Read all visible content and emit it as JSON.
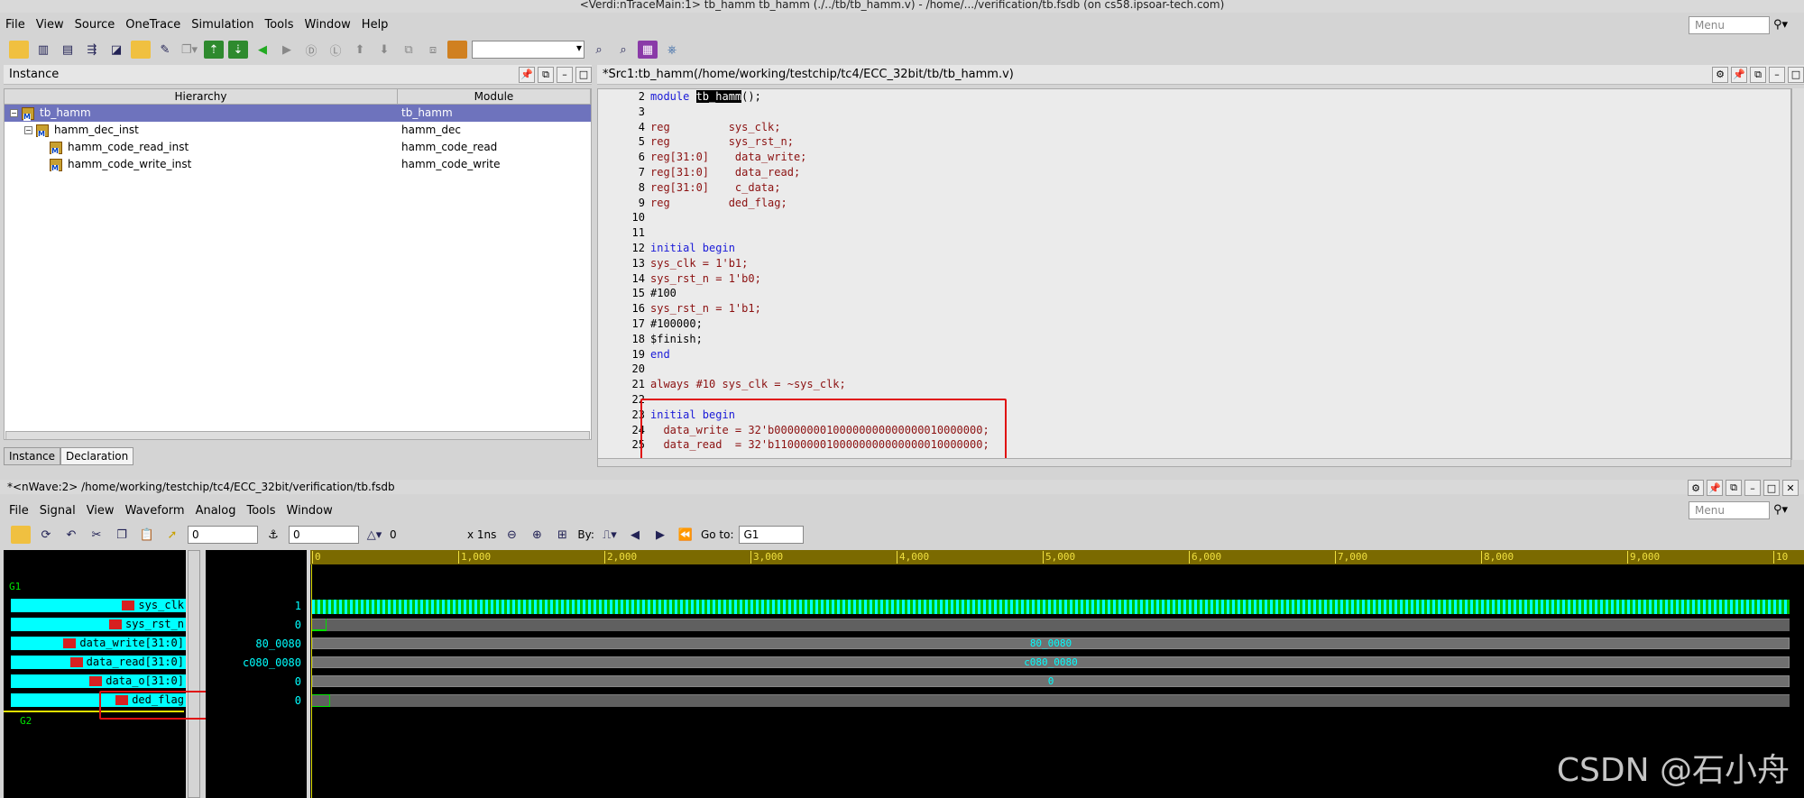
{
  "window": {
    "title": "<Verdi:nTraceMain:1> tb_hamm tb_hamm (./../tb/tb_hamm.v) - /home/.../verification/tb.fsdb (on cs58.ipsoar-tech.com)",
    "menu": [
      "File",
      "View",
      "Source",
      "OneTrace",
      "Simulation",
      "Tools",
      "Window",
      "Help"
    ],
    "menu_search_placeholder": "Menu"
  },
  "instance_panel": {
    "title": "Instance",
    "col_hierarchy": "Hierarchy",
    "col_module": "Module",
    "rows": [
      {
        "name": "tb_hamm",
        "module": "tb_hamm"
      },
      {
        "name": "hamm_dec_inst",
        "module": "hamm_dec"
      },
      {
        "name": "hamm_code_read_inst",
        "module": "hamm_code_read"
      },
      {
        "name": "hamm_code_write_inst",
        "module": "hamm_code_write"
      }
    ],
    "tabs": [
      "Instance",
      "Declaration"
    ]
  },
  "source_panel": {
    "title": "*Src1:tb_hamm(/home/working/testchip/tc4/ECC_32bit/tb/tb_hamm.v)",
    "lines": [
      {
        "n": "2",
        "t": "module tb_hamm();"
      },
      {
        "n": "3",
        "t": ""
      },
      {
        "n": "4",
        "t": "reg         sys_clk;"
      },
      {
        "n": "5",
        "t": "reg         sys_rst_n;"
      },
      {
        "n": "6",
        "t": "reg[31:0]    data_write;"
      },
      {
        "n": "7",
        "t": "reg[31:0]    data_read;"
      },
      {
        "n": "8",
        "t": "reg[31:0]    c_data;"
      },
      {
        "n": "9",
        "t": "reg         ded_flag;"
      },
      {
        "n": "10",
        "t": ""
      },
      {
        "n": "11",
        "t": ""
      },
      {
        "n": "12",
        "t": "initial begin"
      },
      {
        "n": "13",
        "t": "sys_clk = 1'b1;"
      },
      {
        "n": "14",
        "t": "sys_rst_n = 1'b0;"
      },
      {
        "n": "15",
        "t": "#100"
      },
      {
        "n": "16",
        "t": "sys_rst_n = 1'b1;"
      },
      {
        "n": "17",
        "t": "#100000;"
      },
      {
        "n": "18",
        "t": "$finish;"
      },
      {
        "n": "19",
        "t": "end"
      },
      {
        "n": "20",
        "t": ""
      },
      {
        "n": "21",
        "t": "always #10 sys_clk = ~sys_clk;"
      },
      {
        "n": "22",
        "t": ""
      },
      {
        "n": "23",
        "t": "initial begin"
      },
      {
        "n": "24",
        "t": "  data_write = 32'b00000000100000000000000010000000;"
      },
      {
        "n": "25",
        "t": "  data_read  = 32'b11000000100000000000000010000000;"
      }
    ]
  },
  "wave": {
    "title": "*<nWave:2> /home/working/testchip/tc4/ECC_32bit/verification/tb.fsdb",
    "menu": [
      "File",
      "Signal",
      "View",
      "Waveform",
      "Analog",
      "Tools",
      "Window"
    ],
    "cursor_value": "0",
    "marker_value": "0",
    "delta_value": "0",
    "unit": "x 1ns",
    "by_label": "By:",
    "goto_label": "Go to:",
    "goto_value": "G1",
    "groups": [
      "G1",
      "G2"
    ],
    "signals": [
      {
        "name": "sys_clk",
        "value": "1"
      },
      {
        "name": "sys_rst_n",
        "value": "0"
      },
      {
        "name": "data_write[31:0]",
        "value": "80_0080"
      },
      {
        "name": "data_read[31:0]",
        "value": "c080_0080"
      },
      {
        "name": "data_o[31:0]",
        "value": "0"
      },
      {
        "name": "ded_flag",
        "value": "0"
      }
    ],
    "ruler_ticks": [
      "0",
      "1,000",
      "2,000",
      "3,000",
      "4,000",
      "5,000",
      "6,000",
      "7,000",
      "8,000",
      "9,000",
      "10"
    ],
    "bus_labels": {
      "data_write": "80_0080",
      "data_read": "c080_0080",
      "data_o": "0"
    }
  },
  "watermark": "CSDN @石小舟"
}
